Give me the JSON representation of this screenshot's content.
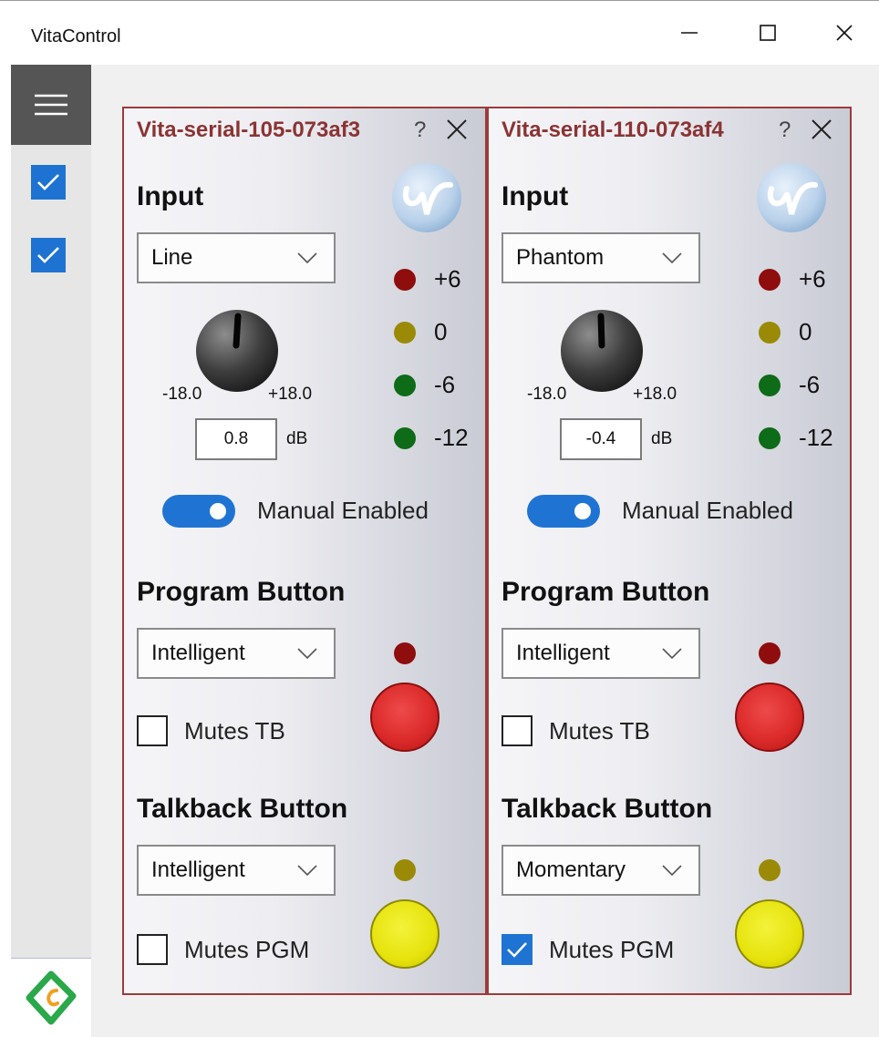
{
  "window": {
    "title": "VitaControl"
  },
  "sidebar": {
    "items": [
      {
        "name": "device-1-toggle",
        "checked": true
      },
      {
        "name": "device-2-toggle",
        "checked": true
      }
    ]
  },
  "panels": [
    {
      "title": "Vita-serial-105-073af3",
      "help": "?",
      "input_label": "Input",
      "input_value": "Line",
      "meter": [
        {
          "label": "+6",
          "color": "#8f0d0d"
        },
        {
          "label": "0",
          "color": "#9a8a06"
        },
        {
          "label": "-6",
          "color": "#0e6b17"
        },
        {
          "label": "-12",
          "color": "#0e6b17"
        }
      ],
      "knob_min": "-18.0",
      "knob_max": "+18.0",
      "gain_value": "0.8",
      "gain_unit": "dB",
      "manual_label": "Manual Enabled",
      "manual_enabled": true,
      "program_label": "Program Button",
      "program_mode": "Intelligent",
      "mutes_tb_label": "Mutes TB",
      "mutes_tb_checked": false,
      "talkback_label": "Talkback Button",
      "talkback_mode": "Intelligent",
      "mutes_pgm_label": "Mutes PGM",
      "mutes_pgm_checked": false
    },
    {
      "title": "Vita-serial-110-073af4",
      "help": "?",
      "input_label": "Input",
      "input_value": "Phantom",
      "meter": [
        {
          "label": "+6",
          "color": "#8f0d0d"
        },
        {
          "label": "0",
          "color": "#9a8a06"
        },
        {
          "label": "-6",
          "color": "#0e6b17"
        },
        {
          "label": "-12",
          "color": "#0e6b17"
        }
      ],
      "knob_min": "-18.0",
      "knob_max": "+18.0",
      "gain_value": "-0.4",
      "gain_unit": "dB",
      "manual_label": "Manual Enabled",
      "manual_enabled": true,
      "program_label": "Program Button",
      "program_mode": "Intelligent",
      "mutes_tb_label": "Mutes TB",
      "mutes_tb_checked": false,
      "talkback_label": "Talkback Button",
      "talkback_mode": "Momentary",
      "mutes_pgm_label": "Mutes PGM",
      "mutes_pgm_checked": true
    }
  ],
  "colors": {
    "accent": "#1f74d3",
    "panel_border": "#9e3a3a",
    "panel_title": "#8b3333",
    "sidebar_dark": "#555555",
    "program_button": "#dc2b2b",
    "talkback_button": "#e6e30e"
  }
}
